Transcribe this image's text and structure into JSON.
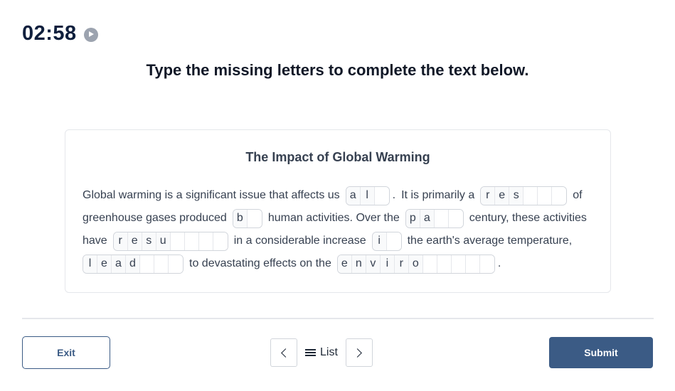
{
  "timer": {
    "time": "02:58",
    "icon": "play-icon"
  },
  "instruction": "Type the missing letters to complete the text below.",
  "passage": {
    "title": "The Impact of Global Warming",
    "lines": [
      [
        {
          "type": "text",
          "value": "Global warming is a significant issue that affects us"
        },
        {
          "type": "blank",
          "given": [
            "a",
            "l"
          ],
          "empty": 1
        },
        {
          "type": "punct",
          "value": "."
        },
        {
          "type": "text",
          "value": "It is primarily a"
        },
        {
          "type": "blank",
          "given": [
            "r",
            "e",
            "s"
          ],
          "empty": 3
        },
        {
          "type": "text",
          "value": "of"
        }
      ],
      [
        {
          "type": "text",
          "value": "greenhouse gases produced"
        },
        {
          "type": "blank",
          "given": [
            "b"
          ],
          "empty": 1
        },
        {
          "type": "text",
          "value": "human activities. Over the"
        },
        {
          "type": "blank",
          "given": [
            "p",
            "a"
          ],
          "empty": 2
        },
        {
          "type": "text",
          "value": "century, these activities"
        }
      ],
      [
        {
          "type": "text",
          "value": "have"
        },
        {
          "type": "blank",
          "given": [
            "r",
            "e",
            "s",
            "u"
          ],
          "empty": 4
        },
        {
          "type": "text",
          "value": "in a considerable increase"
        },
        {
          "type": "blank",
          "given": [
            "i"
          ],
          "empty": 1
        },
        {
          "type": "text",
          "value": "the earth's average temperature,"
        }
      ],
      [
        {
          "type": "blank",
          "given": [
            "l",
            "e",
            "a",
            "d"
          ],
          "empty": 3
        },
        {
          "type": "text",
          "value": "to devastating effects on the"
        },
        {
          "type": "blank",
          "given": [
            "e",
            "n",
            "v",
            "i",
            "r",
            "o"
          ],
          "empty": 5
        },
        {
          "type": "punct",
          "value": "."
        }
      ]
    ]
  },
  "footer": {
    "exit_label": "Exit",
    "prev_icon": "chevron-left-icon",
    "list_label": "List",
    "list_icon": "menu-icon",
    "next_icon": "chevron-right-icon",
    "submit_label": "Submit"
  },
  "colors": {
    "primary": "#3b5b85",
    "timer": "#0f1f3d",
    "border": "#d1d5db"
  }
}
